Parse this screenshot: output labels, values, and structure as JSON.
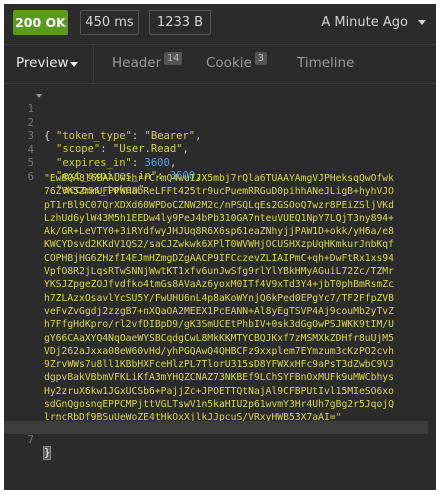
{
  "status_bar": {
    "status": "200 OK",
    "time": "450 ms",
    "size": "1233 B",
    "history": "A Minute Ago"
  },
  "tabs": [
    {
      "label": "Preview",
      "badge": ""
    },
    {
      "label": "Header",
      "badge": "14"
    },
    {
      "label": "Cookie",
      "badge": "3"
    },
    {
      "label": "Timeline",
      "badge": ""
    }
  ],
  "code": {
    "line_numbers": [
      "1",
      "2",
      "3",
      "4",
      "5",
      "6",
      "7"
    ],
    "open_brace": "{",
    "close_brace": "}",
    "token_type_key": "\"token_type\"",
    "token_type_value": "\"Bearer\"",
    "scope_key": "\"scope\"",
    "scope_value": "\"User.Read\"",
    "expires_in_key": "\"expires_in\"",
    "expires_in_value": "3600",
    "ext_expires_in_key": "\"ext_expires_in\"",
    "ext_expires_in_value": "3600",
    "access_token_key": "\"access_token\"",
    "access_token_value": "\"EwBQA8l6BAAUwihrrCrmQ4wuIJX5mbj7rQla6TUAAYAmgVJPHeksqQwOfwk76ZVh5ZmmUFPPWHabReLFFt425tr9ucPuemRRGuD0pihhANeJLigB+hyhVJOpT1rBl9C07QrXDXd60WPDoCZNW2M2c/nPSQLqEs2GSOoQ7wzr8PEiZSljVKdLzhUd6ylW43M5h1EEDw4ly9PeJ4bPb310GA7nteuVUEQ1NpY7LQjT3ny894+Ak/GR+LeVTY0+3iRYdfwyJHJUq8R6X6sp61eaZNhyjjPAW1D+okk/yH6a/e8KWCYDsvd2KKdV1QS2/saCJZwkwk6XPlT0WVWHjOCUSHXzpUqHKmkurJnbKqfCOPHBjHG6ZHzfI4EJmHZmgDZgAACP9IFCczevZLIAIPmC+qh+DwFtRx1xs94VpfO8R2jLqsRTwSNNjWwtKT1xfv6unJwSfg9rlYlYBkHMyAGuiL72Zc/TZMrYKSJZpgeZOJfvdfko4tmGs8AVaAz6yoxM0ITf4V9xTd3Y4+jbT0phBmRsmZch7ZLAzxOsavlYcSU5Y/FwUHU6nL4p8aKoWYnjQ6kPed0EPgYc7/TF2FfpZVBveFvZvGgdj2zzgB7+nXQaOA2MEEX1PcEANN+Al8yEgTSVP4Aj9couMb2yTvZh7FfgHdKpro/rl2vfDIBpD9/gK3SmUCEtPhbIV+0sk3dGgOwPSJWKK9tIM/UgY66CAaXYQ4NqOaeWYSBCqdgCwL8MkKKMTYCBQJKxf7zMSMXkZDHfr8uUjM5VDj262aJxxa08eW60vHd/yhPGQAwQ4QHBCFz9xxplem7EYmzum3cKzPO2cvh9ZrvWWs7u8ll1KBbHXFceHlzPL7TlorU315sD8YFWXxHFc9aPsT3dZwbC9VJdgpvBakVBbmVFKLiKfA3mYHQZCNAZ73NKBEf9LChSYFBnOxMUFk9uMWCbhysHy2zruX6kw1JGxUCSb6+PajjZc+JPOETTQtNajAl9CFBPUtIvl15MIeSO6xosdGnQgosnqEPPCMPjttVGLTswV1n5kaHIU2p61wvmY3Hr4Uh7gBg2r5JqojQlrncRbDf9BSuUeWoZE4tHkOxXjlkJJpcuS/VRxyHWB53X7aAI=\""
  },
  "colors": {
    "status_ok": "#5b9a1f",
    "background": "#2b2b2b",
    "string": "#d8d84a",
    "number": "#56a2e8"
  }
}
